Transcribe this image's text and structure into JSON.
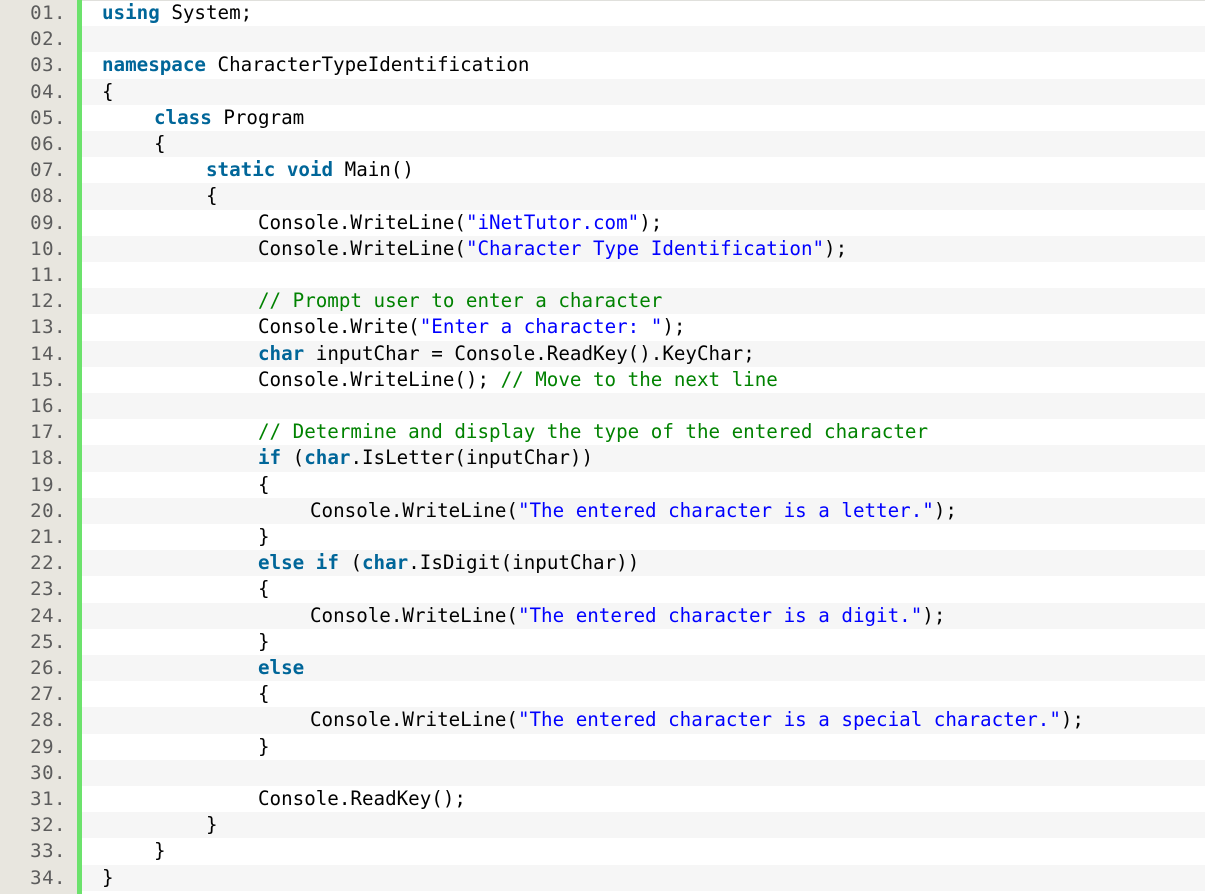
{
  "language": "C#",
  "colors": {
    "gutter_bg": "#e8e6df",
    "gutter_bar": "#6ce26c",
    "line_number": "#5c5c5c",
    "keyword": "#006699",
    "string": "#0000ff",
    "comment": "#008200",
    "plain": "#000000",
    "alt_row": "#f6f6f6"
  },
  "lines": [
    {
      "no": "01.",
      "indent": 0,
      "tokens": [
        [
          "kw",
          "using"
        ],
        [
          "p",
          " System;"
        ]
      ]
    },
    {
      "no": "02.",
      "indent": 0,
      "tokens": []
    },
    {
      "no": "03.",
      "indent": 0,
      "tokens": [
        [
          "kw",
          "namespace"
        ],
        [
          "p",
          " CharacterTypeIdentification"
        ]
      ]
    },
    {
      "no": "04.",
      "indent": 0,
      "tokens": [
        [
          "p",
          "{"
        ]
      ]
    },
    {
      "no": "05.",
      "indent": 1,
      "tokens": [
        [
          "kw",
          "class"
        ],
        [
          "p",
          " Program"
        ]
      ]
    },
    {
      "no": "06.",
      "indent": 1,
      "tokens": [
        [
          "p",
          "{"
        ]
      ]
    },
    {
      "no": "07.",
      "indent": 2,
      "tokens": [
        [
          "kw",
          "static"
        ],
        [
          "p",
          " "
        ],
        [
          "kw",
          "void"
        ],
        [
          "p",
          " Main()"
        ]
      ]
    },
    {
      "no": "08.",
      "indent": 2,
      "tokens": [
        [
          "p",
          "{"
        ]
      ]
    },
    {
      "no": "09.",
      "indent": 3,
      "tokens": [
        [
          "p",
          "Console.WriteLine("
        ],
        [
          "str",
          "\"iNetTutor.com\""
        ],
        [
          "p",
          ");"
        ]
      ]
    },
    {
      "no": "10.",
      "indent": 3,
      "tokens": [
        [
          "p",
          "Console.WriteLine("
        ],
        [
          "str",
          "\"Character Type Identification\""
        ],
        [
          "p",
          ");"
        ]
      ]
    },
    {
      "no": "11.",
      "indent": 0,
      "tokens": []
    },
    {
      "no": "12.",
      "indent": 3,
      "tokens": [
        [
          "cm",
          "// Prompt user to enter a character"
        ]
      ]
    },
    {
      "no": "13.",
      "indent": 3,
      "tokens": [
        [
          "p",
          "Console.Write("
        ],
        [
          "str",
          "\"Enter a character: \""
        ],
        [
          "p",
          ");"
        ]
      ]
    },
    {
      "no": "14.",
      "indent": 3,
      "tokens": [
        [
          "kw",
          "char"
        ],
        [
          "p",
          " inputChar = Console.ReadKey().KeyChar;"
        ]
      ]
    },
    {
      "no": "15.",
      "indent": 3,
      "tokens": [
        [
          "p",
          "Console.WriteLine(); "
        ],
        [
          "cm",
          "// Move to the next line"
        ]
      ]
    },
    {
      "no": "16.",
      "indent": 0,
      "tokens": []
    },
    {
      "no": "17.",
      "indent": 3,
      "tokens": [
        [
          "cm",
          "// Determine and display the type of the entered character"
        ]
      ]
    },
    {
      "no": "18.",
      "indent": 3,
      "tokens": [
        [
          "kw",
          "if"
        ],
        [
          "p",
          " ("
        ],
        [
          "kw",
          "char"
        ],
        [
          "p",
          ".IsLetter(inputChar))"
        ]
      ]
    },
    {
      "no": "19.",
      "indent": 3,
      "tokens": [
        [
          "p",
          "{"
        ]
      ]
    },
    {
      "no": "20.",
      "indent": 4,
      "tokens": [
        [
          "p",
          "Console.WriteLine("
        ],
        [
          "str",
          "\"The entered character is a letter.\""
        ],
        [
          "p",
          ");"
        ]
      ]
    },
    {
      "no": "21.",
      "indent": 3,
      "tokens": [
        [
          "p",
          "}"
        ]
      ]
    },
    {
      "no": "22.",
      "indent": 3,
      "tokens": [
        [
          "kw",
          "else"
        ],
        [
          "p",
          " "
        ],
        [
          "kw",
          "if"
        ],
        [
          "p",
          " ("
        ],
        [
          "kw",
          "char"
        ],
        [
          "p",
          ".IsDigit(inputChar))"
        ]
      ]
    },
    {
      "no": "23.",
      "indent": 3,
      "tokens": [
        [
          "p",
          "{"
        ]
      ]
    },
    {
      "no": "24.",
      "indent": 4,
      "tokens": [
        [
          "p",
          "Console.WriteLine("
        ],
        [
          "str",
          "\"The entered character is a digit.\""
        ],
        [
          "p",
          ");"
        ]
      ]
    },
    {
      "no": "25.",
      "indent": 3,
      "tokens": [
        [
          "p",
          "}"
        ]
      ]
    },
    {
      "no": "26.",
      "indent": 3,
      "tokens": [
        [
          "kw",
          "else"
        ]
      ]
    },
    {
      "no": "27.",
      "indent": 3,
      "tokens": [
        [
          "p",
          "{"
        ]
      ]
    },
    {
      "no": "28.",
      "indent": 4,
      "tokens": [
        [
          "p",
          "Console.WriteLine("
        ],
        [
          "str",
          "\"The entered character is a special character.\""
        ],
        [
          "p",
          ");"
        ]
      ]
    },
    {
      "no": "29.",
      "indent": 3,
      "tokens": [
        [
          "p",
          "}"
        ]
      ]
    },
    {
      "no": "30.",
      "indent": 0,
      "tokens": []
    },
    {
      "no": "31.",
      "indent": 3,
      "tokens": [
        [
          "p",
          "Console.ReadKey();"
        ]
      ]
    },
    {
      "no": "32.",
      "indent": 2,
      "tokens": [
        [
          "p",
          "}"
        ]
      ]
    },
    {
      "no": "33.",
      "indent": 1,
      "tokens": [
        [
          "p",
          "}"
        ]
      ]
    },
    {
      "no": "34.",
      "indent": 0,
      "tokens": [
        [
          "p",
          "}"
        ]
      ]
    }
  ]
}
